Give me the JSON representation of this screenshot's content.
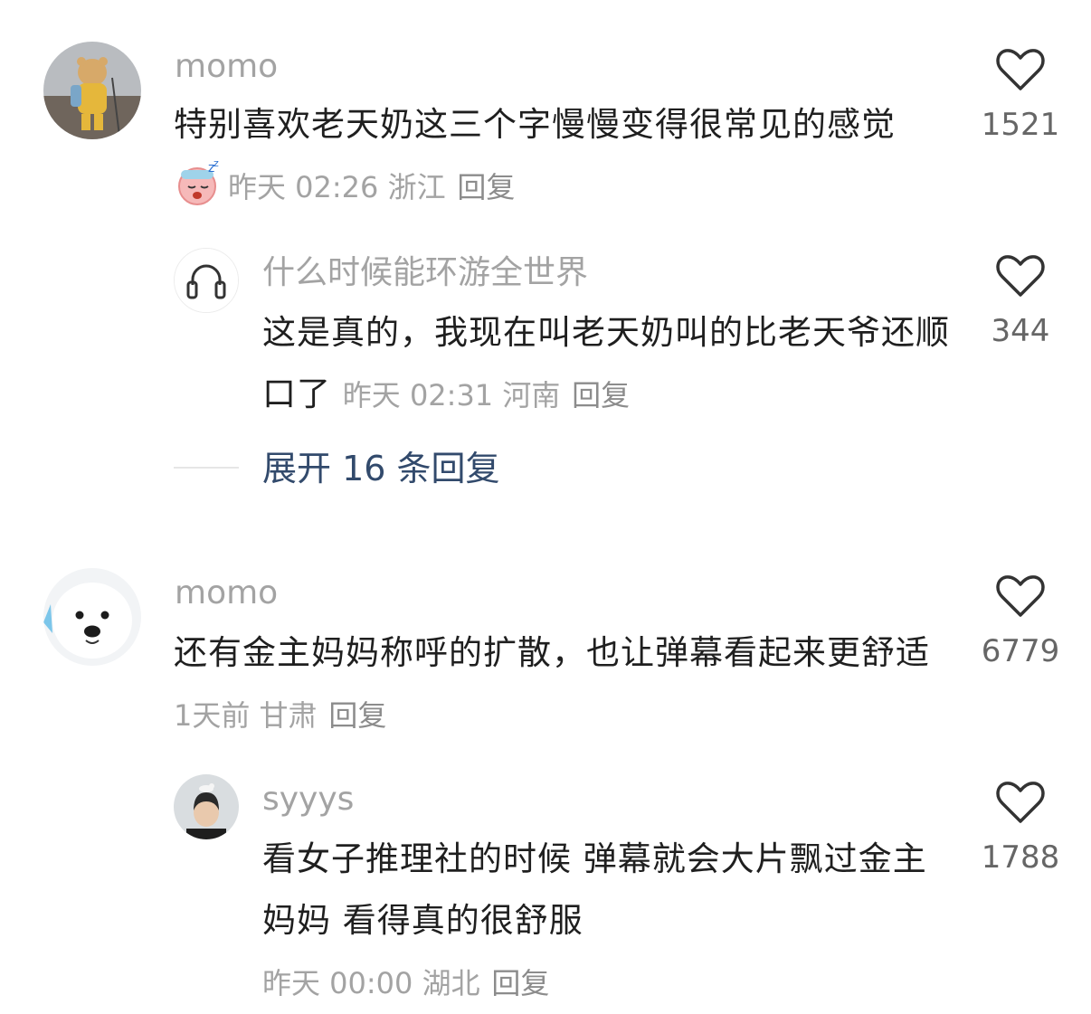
{
  "comments": [
    {
      "username": "momo",
      "text": "特别喜欢老天奶这三个字慢慢变得很常见的感觉",
      "emoji": "sleeping-sick-face-emoji",
      "meta": "昨天 02:26 浙江",
      "reply_label": "回复",
      "likes": "1521",
      "replies": [
        {
          "username": "什么时候能环游全世界",
          "text": "这是真的，我现在叫老天奶叫的比老天爷还顺口了",
          "meta": "昨天 02:31 河南",
          "reply_label": "回复",
          "likes": "344"
        }
      ],
      "expand_label": "展开 16 条回复"
    },
    {
      "username": "momo",
      "text": "还有金主妈妈称呼的扩散，也让弹幕看起来更舒适",
      "meta": "1天前 甘肃",
      "reply_label": "回复",
      "likes": "6779",
      "replies": [
        {
          "username": "syyys",
          "text": "看女子推理社的时候 弹幕就会大片飘过金主妈妈 看得真的很舒服",
          "meta": "昨天 00:00 湖北",
          "reply_label": "回复",
          "likes": "1788"
        }
      ]
    }
  ]
}
